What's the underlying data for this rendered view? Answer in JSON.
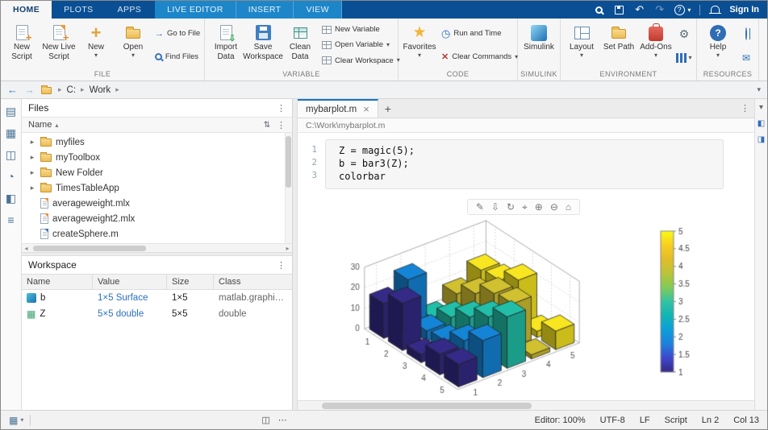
{
  "icons": {
    "caret": "▾",
    "chevron": "▸",
    "kebab": "⋮",
    "ellipsis": "⋯",
    "sort": "▴",
    "sort_order": "⇅",
    "undo": "↶",
    "redo": "↷",
    "close": "×",
    "plus": "+",
    "star": "★",
    "gear": "⚙",
    "mail": "✉",
    "clock": "◷",
    "back": "←",
    "forward": "→",
    "question": "?",
    "clear": "✕",
    "brush": "✎",
    "export": "⇩",
    "rotate": "↻",
    "pan": "⌖",
    "zoom_in": "⊕",
    "zoom_out": "⊖",
    "home": "⌂",
    "go_to": "→",
    "harrow_left": "◂",
    "harrow_right": "▸",
    "sidebar": [
      "▤",
      "▦",
      "◫",
      "◔",
      "◧",
      "≡"
    ],
    "editor_strip": [
      "▾",
      "◧",
      "◨"
    ],
    "statusbar_left": [
      "▦",
      "▾"
    ],
    "statusbar_mid": [
      "◫",
      "⋯"
    ]
  },
  "tabbar": {
    "tabs": [
      {
        "label": "HOME"
      },
      {
        "label": "PLOTS"
      },
      {
        "label": "APPS"
      }
    ],
    "contextual_tabs": [
      {
        "label": "LIVE EDITOR"
      },
      {
        "label": "INSERT"
      },
      {
        "label": "VIEW"
      }
    ],
    "sign_in": "Sign In"
  },
  "ribbon": {
    "sections": [
      {
        "label": "FILE"
      },
      {
        "label": "VARIABLE"
      },
      {
        "label": "CODE"
      },
      {
        "label": "SIMULINK"
      },
      {
        "label": "ENVIRONMENT"
      },
      {
        "label": "RESOURCES"
      }
    ],
    "file": {
      "new_script": "New Script",
      "new_live_script": "New Live Script",
      "new": "New",
      "open": "Open",
      "go_to_file": "Go to File",
      "find_files": "Find Files"
    },
    "variable": {
      "import_data": "Import Data",
      "save_workspace": "Save Workspace",
      "clean_data": "Clean Data",
      "new_variable": "New Variable",
      "open_variable": "Open Variable",
      "clear_workspace": "Clear Workspace"
    },
    "code": {
      "favorites": "Favorites",
      "run_and_time": "Run and Time",
      "clear_commands": "Clear Commands"
    },
    "simulink": {
      "simulink": "Simulink"
    },
    "environment": {
      "layout": "Layout",
      "set_path": "Set Path",
      "add_ons": "Add-Ons"
    },
    "resources": {
      "help": "Help"
    }
  },
  "addressbar": {
    "breadcrumb": [
      "C:",
      "Work"
    ]
  },
  "files_panel": {
    "title": "Files",
    "column": "Name",
    "folders": [
      "myfiles",
      "myToolbox",
      "New Folder",
      "TimesTableApp"
    ],
    "files": [
      "averageweight.mlx",
      "averageweight2.mlx",
      "createSphere.m"
    ]
  },
  "workspace_panel": {
    "title": "Workspace",
    "columns": [
      "Name",
      "Value",
      "Size",
      "Class"
    ],
    "rows": [
      {
        "name": "b",
        "value": "1×5 Surface",
        "size": "1×5",
        "class": "matlab.graphi…"
      },
      {
        "name": "Z",
        "value": "5×5 double",
        "size": "5×5",
        "class": "double"
      }
    ]
  },
  "editor": {
    "tab": "mybarplot.m",
    "path": "C:\\Work\\mybarplot.m",
    "code": [
      {
        "n": "1",
        "text": "Z = magic(5);"
      },
      {
        "n": "2",
        "text": "b = bar3(Z);"
      },
      {
        "n": "3",
        "text": "colorbar"
      }
    ]
  },
  "chart_data": {
    "type": "bar",
    "subtype": "3d-bar3",
    "title": "",
    "z_matrix": [
      [
        17,
        24,
        1,
        8,
        15
      ],
      [
        23,
        5,
        7,
        14,
        16
      ],
      [
        4,
        6,
        13,
        20,
        22
      ],
      [
        10,
        12,
        19,
        21,
        3
      ],
      [
        11,
        18,
        25,
        2,
        9
      ]
    ],
    "x_ticks": [
      1,
      2,
      3,
      4,
      5
    ],
    "y_ticks": [
      1,
      2,
      3,
      4,
      5
    ],
    "z_ticks": [
      0,
      10,
      20,
      30
    ],
    "zlim": [
      0,
      30
    ],
    "grid": true,
    "series_colors": [
      "#352A87",
      "#1484D6",
      "#21BFA8",
      "#D1C02F",
      "#F7E620"
    ],
    "colorbar": {
      "min": 1,
      "max": 5,
      "ticks": [
        "1",
        "1.5",
        "2",
        "2.5",
        "3",
        "3.5",
        "4",
        "4.5",
        "5"
      ],
      "gradient": [
        "#352A87",
        "#3F47CC",
        "#1E81DD",
        "#0C9FDA",
        "#12B5B6",
        "#34C3A3",
        "#81CC59",
        "#BBC439",
        "#E3BD29",
        "#F9CE22",
        "#F9FB14"
      ]
    }
  },
  "statusbar": {
    "zoom": "Editor: 100%",
    "encoding": "UTF-8",
    "eol": "LF",
    "file_type": "Script",
    "line": "Ln 2",
    "column": "Col 13"
  }
}
